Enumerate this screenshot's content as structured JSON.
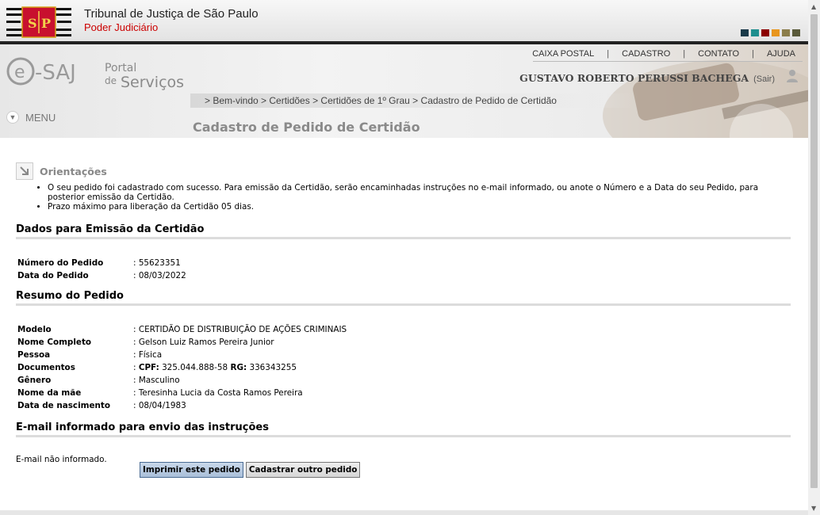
{
  "header": {
    "title": "Tribunal de Justiça de São Paulo",
    "subtitle": "Poder Judiciário",
    "swatches": [
      "#1a3a4a",
      "#1e8e8e",
      "#8b0000",
      "#e8961e",
      "#8b7d4a",
      "#5a5a3a"
    ]
  },
  "portal": {
    "top_menu": [
      "CAIXA POSTAL",
      "CADASTRO",
      "CONTATO",
      "AJUDA"
    ],
    "user_name": "GUSTAVO ROBERTO PERUSSI BACHEGA",
    "logout": "(Sair)",
    "breadcrumb": "> Bem-vindo > Certidões > Certidões de 1º Grau > Cadastro de Pedido de Certidão",
    "menu_label": "MENU",
    "page_title": "Cadastro de Pedido de Certidão"
  },
  "orientacoes": {
    "title": "Orientações",
    "items": [
      "O seu pedido foi cadastrado com sucesso. Para emissão da Certidão, serão encaminhadas instruções no e-mail informado, ou anote o Número e a Data do seu Pedido, para posterior emissão da Certidão.",
      "Prazo máximo para liberação da Certidão 05 dias."
    ]
  },
  "dados": {
    "title": "Dados para Emissão da Certidão",
    "rows": [
      {
        "label": "Número do Pedido",
        "value": "55623351"
      },
      {
        "label": "Data do Pedido",
        "value": "08/03/2022"
      }
    ]
  },
  "resumo": {
    "title": "Resumo do Pedido",
    "rows": [
      {
        "label": "Modelo",
        "value": "CERTIDÃO DE DISTRIBUIÇÃO DE AÇÕES CRIMINAIS"
      },
      {
        "label": "Nome Completo",
        "value": "Gelson Luiz Ramos Pereira Junior"
      },
      {
        "label": "Pessoa",
        "value": "Física"
      },
      {
        "label": "Documentos",
        "cpf_label": "CPF:",
        "cpf": "325.044.888-58",
        "rg_label": "RG:",
        "rg": "336343255"
      },
      {
        "label": "Gênero",
        "value": "Masculino"
      },
      {
        "label": "Nome da mãe",
        "value": "Teresinha Lucia da Costa Ramos Pereira"
      },
      {
        "label": "Data de nascimento",
        "value": "08/04/1983"
      }
    ]
  },
  "email": {
    "title": "E-mail informado para envio das instruções",
    "text": "E-mail não informado."
  },
  "buttons": {
    "print": "Imprimir este pedido",
    "new": "Cadastrar outro pedido"
  }
}
